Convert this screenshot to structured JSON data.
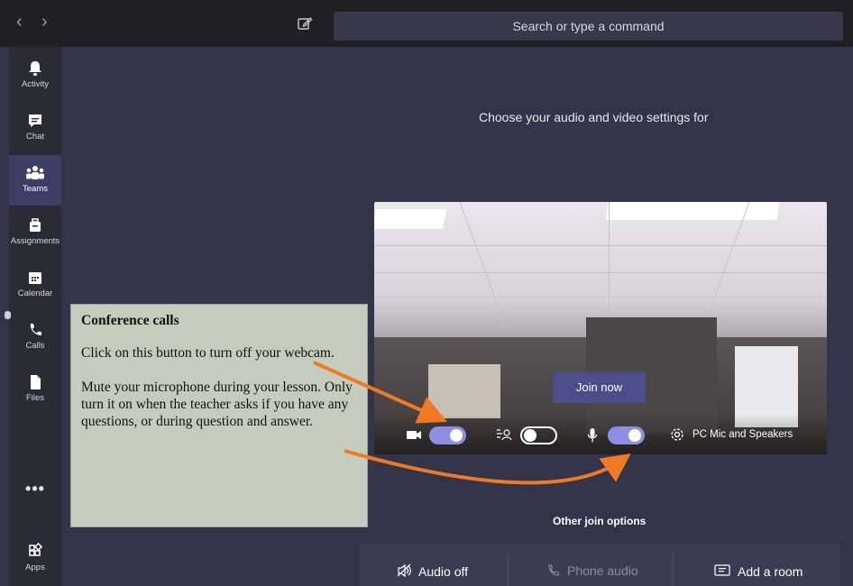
{
  "topbar": {
    "back_icon": "chevron-left-icon",
    "forward_icon": "chevron-right-icon",
    "compose_icon": "compose-icon",
    "search_placeholder": "Search or type a command"
  },
  "sidebar": {
    "items": [
      {
        "label": "Activity",
        "icon": "bell-icon"
      },
      {
        "label": "Chat",
        "icon": "chat-icon"
      },
      {
        "label": "Teams",
        "icon": "teams-icon"
      },
      {
        "label": "Assignments",
        "icon": "assignments-icon"
      },
      {
        "label": "Calendar",
        "icon": "calendar-icon"
      },
      {
        "label": "Calls",
        "icon": "phone-icon"
      },
      {
        "label": "Files",
        "icon": "file-icon"
      }
    ],
    "more_label": "•••",
    "apps_label": "Apps",
    "active_item": "Teams"
  },
  "main": {
    "heading": "Choose your audio and video settings for",
    "join_button": "Join now",
    "controls": {
      "camera_on": true,
      "blur_on": false,
      "mic_on": true,
      "device_label": "PC Mic and Speakers"
    },
    "other_join_options": "Other join options",
    "bottom_options": {
      "audio_off": "Audio off",
      "phone_audio": "Phone audio",
      "add_room": "Add a room"
    }
  },
  "callout": {
    "title": "Conference calls",
    "paragraph1": "Click on this button to turn off your webcam.",
    "paragraph2": "Mute your microphone during your lesson. Only turn it on when the teacher asks if you have any questions, or during question and answer."
  },
  "colors": {
    "background": "#33344a",
    "topbar": "#202023",
    "sidebar": "#2b2b36",
    "accent": "#8d8fe0",
    "join_button": "#4b4e8a",
    "callout_bg": "#c4cdbd",
    "arrow": "#f07a24"
  }
}
